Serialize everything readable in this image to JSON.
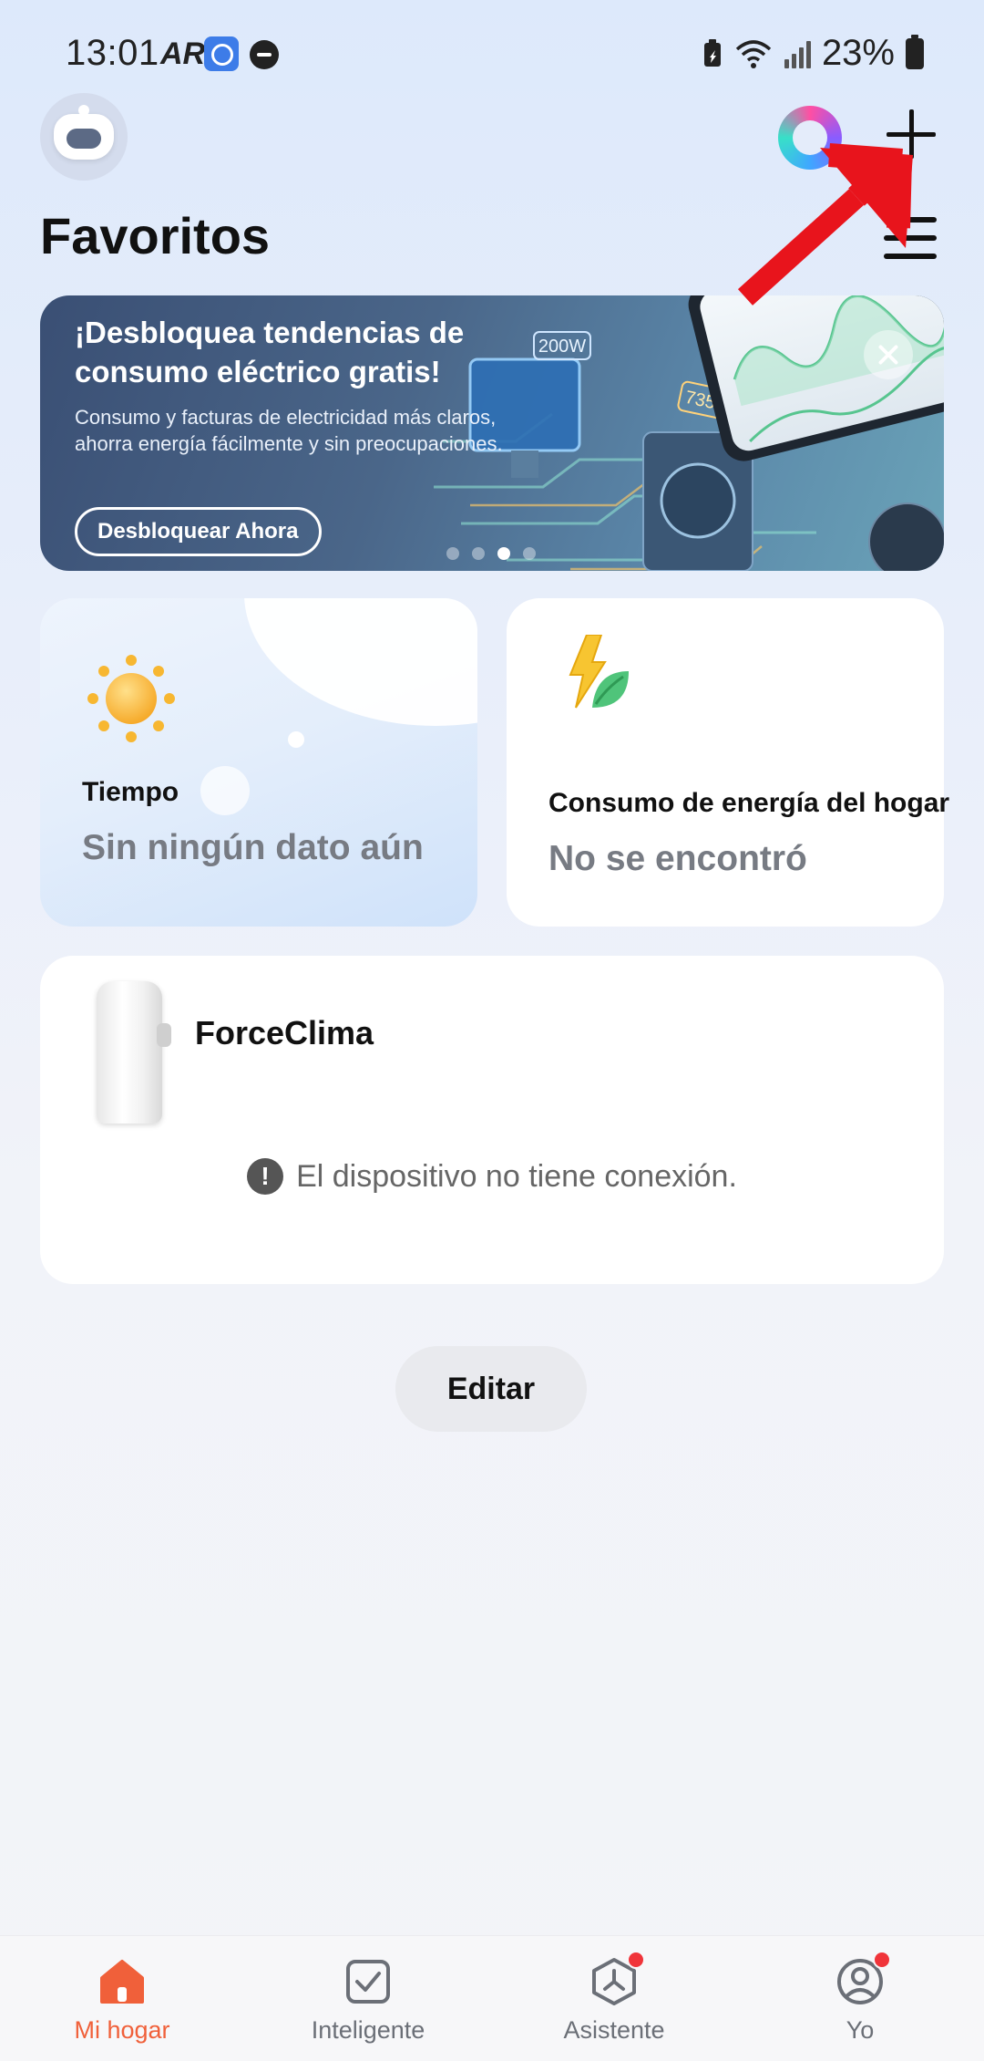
{
  "status_bar": {
    "time": "13:01",
    "battery": "23%"
  },
  "header": {
    "title": "Favoritos"
  },
  "banner": {
    "title": "¡Desbloquea tendencias de consumo eléctrico gratis!",
    "description": "Consumo y facturas de electricidad más claros, ahorra energía fácilmente y sin preocupaciones.",
    "button_label": "Desbloquear Ahora",
    "tag_1": "200W",
    "tag_2": "735W",
    "active_slide": 3,
    "slide_count": 4
  },
  "weather_card": {
    "label": "Tiempo",
    "value": "Sin ningún dato aún"
  },
  "energy_card": {
    "label": "Consumo de energía del hogar",
    "value": "No se encontró"
  },
  "device_card": {
    "name": "ForceClima",
    "status": "El dispositivo no tiene conexión."
  },
  "edit_button": "Editar",
  "bottom_nav": {
    "items": [
      {
        "label": "Mi hogar",
        "icon": "home-icon",
        "active": true
      },
      {
        "label": "Inteligente",
        "icon": "checkbox-icon",
        "active": false
      },
      {
        "label": "Asistente",
        "icon": "assistant-icon",
        "active": false,
        "badge": true
      },
      {
        "label": "Yo",
        "icon": "profile-icon",
        "active": false,
        "badge": true
      }
    ]
  },
  "colors": {
    "accent": "#f0603a",
    "annotation_arrow": "#e8141c",
    "badge": "#f0343a"
  }
}
